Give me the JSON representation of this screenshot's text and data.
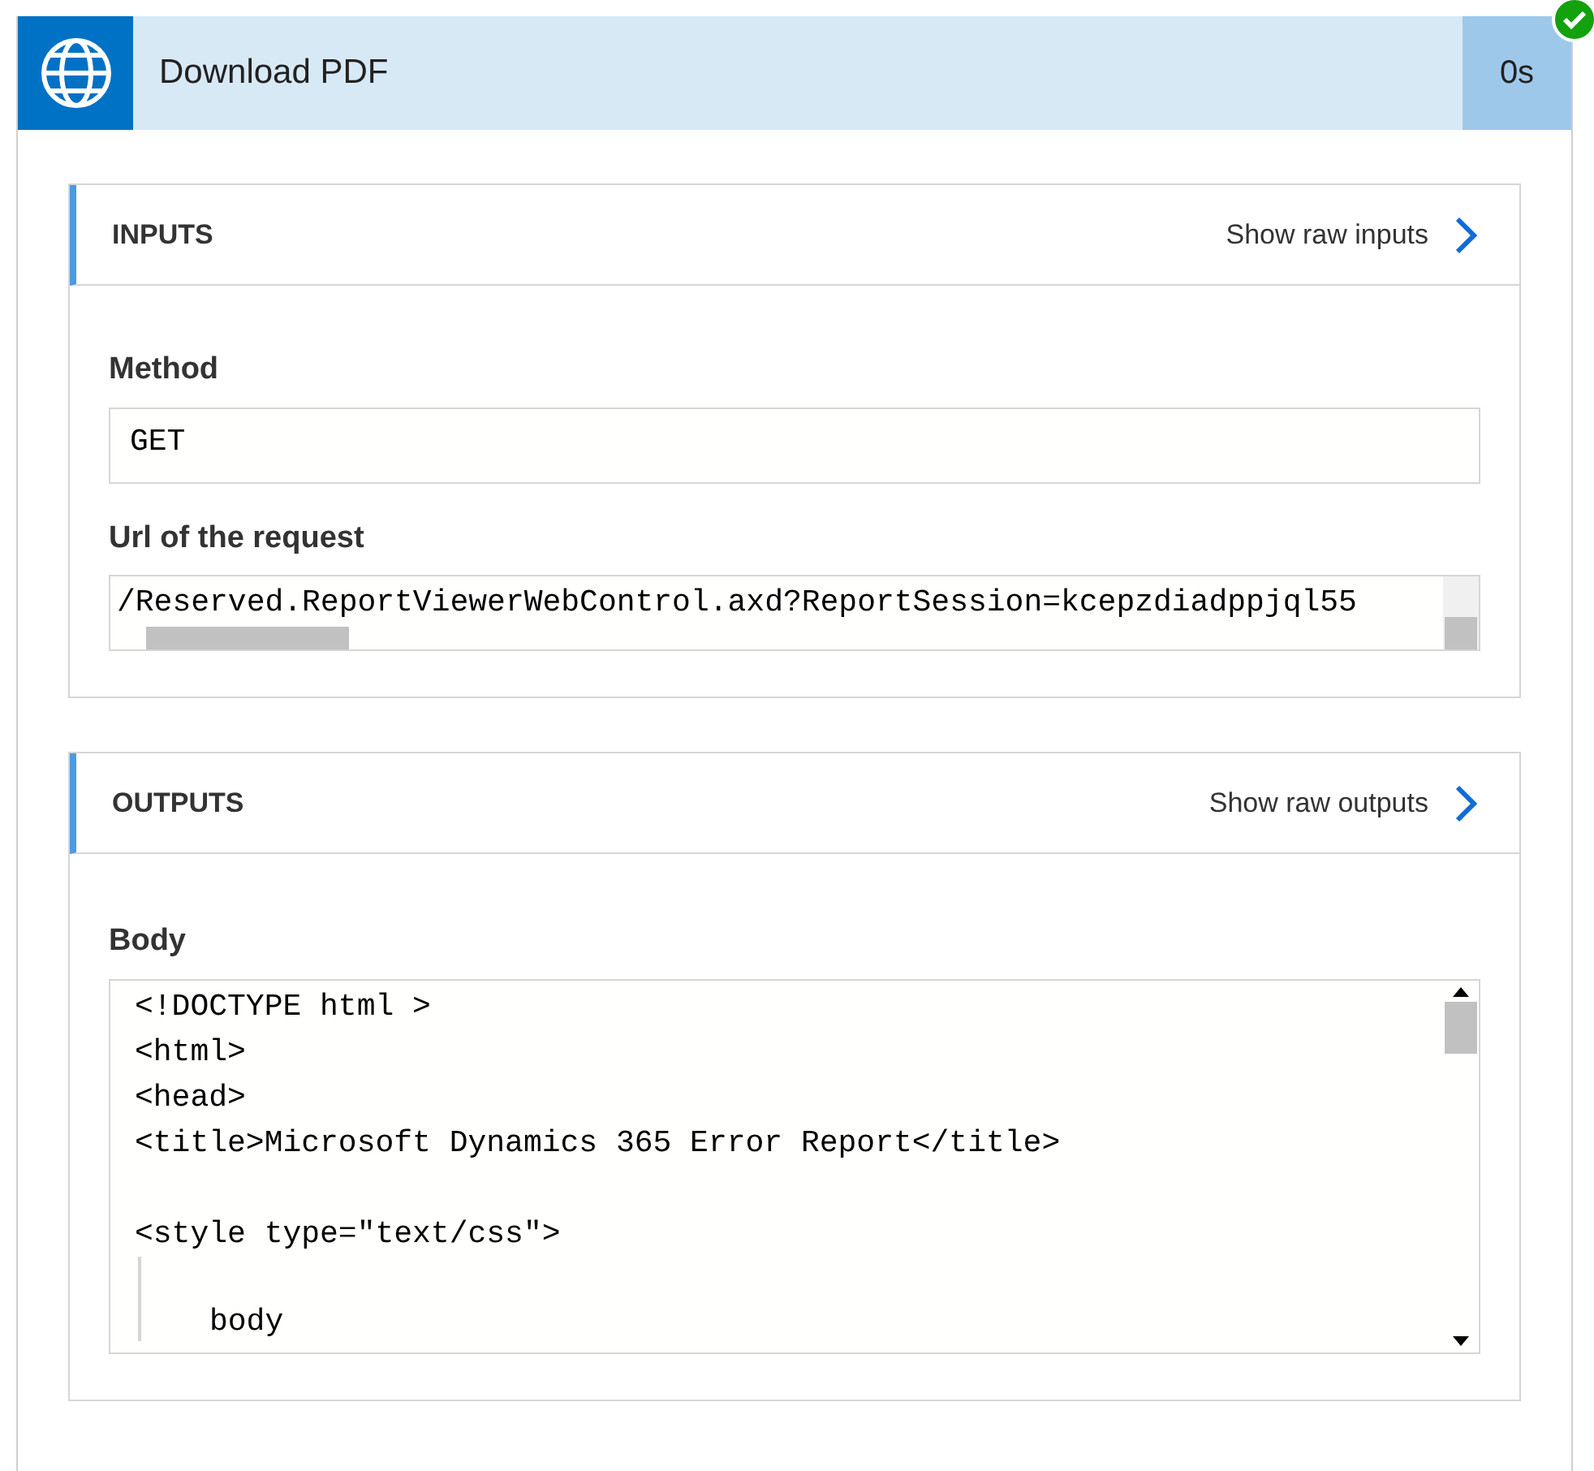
{
  "action": {
    "title": "Download PDF",
    "duration": "0s",
    "succeeded": true
  },
  "inputs": {
    "heading": "INPUTS",
    "raw_link": "Show raw inputs",
    "fields": [
      {
        "label": "Method",
        "value": "GET",
        "kind": "plain"
      },
      {
        "label": "Url of the request",
        "value": "/Reserved.ReportViewerWebControl.axd?ReportSession=kcepzdiadppjql55",
        "kind": "scroll"
      }
    ]
  },
  "outputs": {
    "heading": "OUTPUTS",
    "raw_link": "Show raw outputs",
    "body_label": "Body",
    "body_lines": [
      {
        "kind": "line",
        "text": "<!DOCTYPE html >"
      },
      {
        "kind": "line",
        "text": "<html>"
      },
      {
        "kind": "line",
        "text": "<head>"
      },
      {
        "kind": "line",
        "text": "<title>Microsoft Dynamics 365 Error Report</title>"
      },
      {
        "kind": "blank"
      },
      {
        "kind": "line",
        "text": "<style type=\"text/css\">"
      },
      {
        "kind": "blank-guide"
      },
      {
        "kind": "indented",
        "text": "body"
      }
    ]
  }
}
